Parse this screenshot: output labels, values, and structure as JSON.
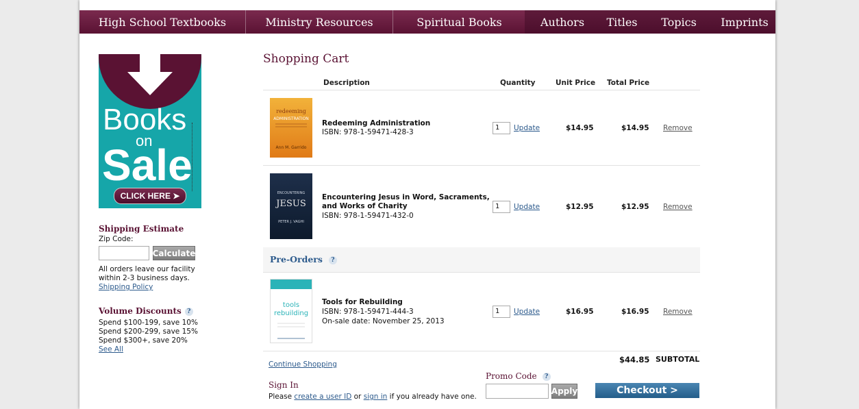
{
  "nav": {
    "items": [
      "High School Textbooks",
      "Ministry Resources",
      "Spiritual Books",
      "Authors",
      "Titles",
      "Topics",
      "Imprints"
    ]
  },
  "banner": {
    "line1": "Books",
    "line2": "on",
    "line3": "Sale",
    "button": "CLICK HERE ➤"
  },
  "sidebar": {
    "shipping_title": "Shipping Estimate",
    "zip_label": "Zip Code:",
    "calculate": "Calculate",
    "shipping_note_1": "All orders leave our facility",
    "shipping_note_2": "within 2-3 business days.",
    "shipping_policy": "Shipping Policy",
    "volume_title": "Volume Discounts",
    "help": "?",
    "discount_1": "Spend $100-199, save 10%",
    "discount_2": "Spend $200-299, save 15%",
    "discount_3": "Spend $300+, save 20%",
    "see_all": "See All"
  },
  "cart": {
    "title": "Shopping Cart",
    "headers": {
      "description": "Description",
      "quantity": "Quantity",
      "unit_price": "Unit Price",
      "total_price": "Total Price"
    },
    "items": [
      {
        "title": "Redeeming Administration",
        "isbn": "ISBN: 978-1-59471-428-3",
        "qty": "1",
        "update": "Update",
        "unit": "$14.95",
        "total": "$14.95",
        "remove": "Remove",
        "cover_text": "Redeeming Administration",
        "cover_author": "Ann M. Garrido"
      },
      {
        "title1": "Encountering Jesus in Word, Sacraments,",
        "title2": "and Works of Charity",
        "isbn": "ISBN: 978-1-59471-432-0",
        "qty": "1",
        "update": "Update",
        "unit": "$12.95",
        "total": "$12.95",
        "remove": "Remove",
        "cover_text": "JESUS",
        "cover_top": "ENCOUNTERING",
        "cover_author": "PETER J. VAGHI"
      }
    ],
    "preorders_label": "Pre-Orders",
    "preorder": {
      "title": "Tools for Rebuilding",
      "isbn": "ISBN: 978-1-59471-444-3",
      "onsale": "On-sale date: November 25, 2013",
      "qty": "1",
      "update": "Update",
      "unit": "$16.95",
      "total": "$16.95",
      "remove": "Remove",
      "cover_line1": "tools",
      "cover_line2": "rebuilding"
    },
    "subtotal_value": "$44.85",
    "subtotal_label": "SUBTOTAL",
    "continue": "Continue Shopping",
    "signin_title": "Sign In",
    "signin_pre": "Please ",
    "signin_create": "create a user ID",
    "signin_or": " or ",
    "signin_link": "sign in",
    "signin_post": " if you already have one.",
    "promo_title": "Promo Code",
    "apply": "Apply",
    "checkout": "Checkout >"
  },
  "colors": {
    "brand": "#5a1233",
    "link": "#2c5a8c",
    "banner_teal": "#16a6a9",
    "checkout_blue": "#2f6f9e"
  }
}
